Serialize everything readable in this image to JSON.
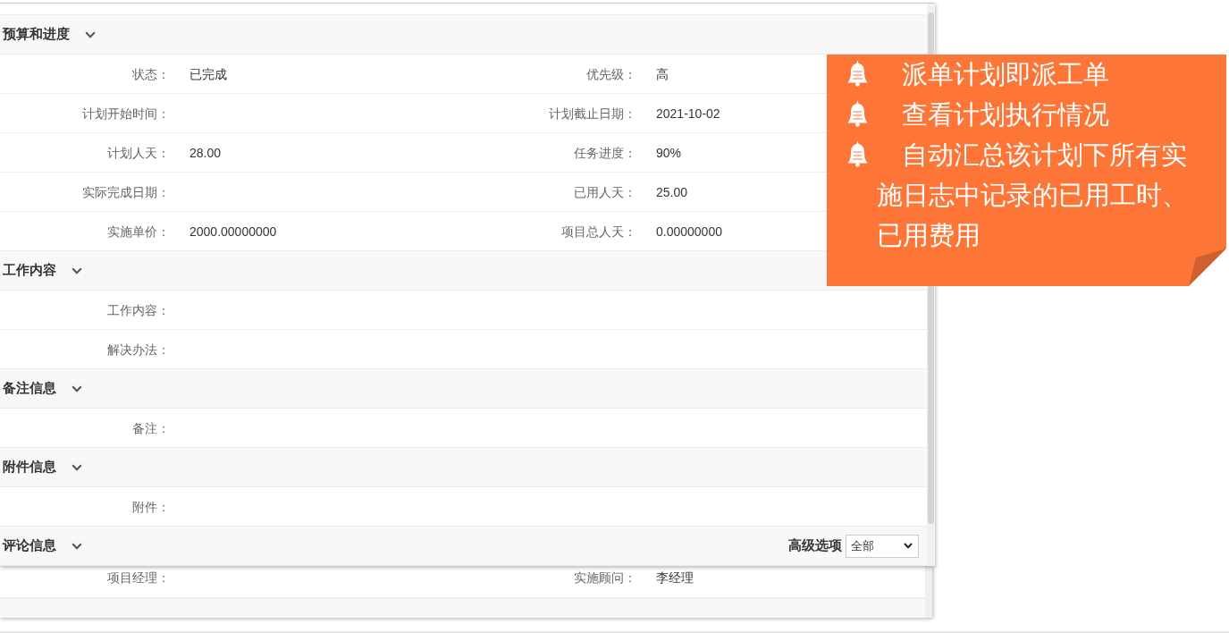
{
  "form": {
    "sections": [
      {
        "title": "预算和进度",
        "expanded": true,
        "rows": [
          {
            "fields": [
              {
                "label": "状态：",
                "value": "已完成"
              },
              {
                "label": "优先级：",
                "value": "高"
              }
            ]
          },
          {
            "fields": [
              {
                "label": "计划开始时间："
              },
              {
                "label": "计划截止日期：",
                "value": "2021-10-02"
              }
            ]
          },
          {
            "fields": [
              {
                "label": "计划人天：",
                "value": "28.00"
              },
              {
                "label": "任务进度：",
                "value": "90%"
              }
            ]
          },
          {
            "fields": [
              {
                "label": "实际完成日期："
              },
              {
                "label": "已用人天：",
                "value": "25.00"
              }
            ]
          },
          {
            "fields": [
              {
                "label": "实施单价：",
                "value": "2000.00000000"
              },
              {
                "label": "项目总人天：",
                "value": "0.00000000"
              }
            ]
          }
        ]
      },
      {
        "title": "工作内容",
        "expanded": true,
        "rows": [
          {
            "fields": [
              {
                "label": "工作内容："
              }
            ]
          },
          {
            "fields": [
              {
                "label": "解决办法："
              }
            ]
          }
        ]
      },
      {
        "title": "备注信息",
        "expanded": true,
        "rows": [
          {
            "fields": [
              {
                "label": "备注："
              }
            ]
          }
        ]
      },
      {
        "title": "附件信息",
        "expanded": true,
        "rows": [
          {
            "fields": [
              {
                "label": "附件："
              }
            ]
          }
        ]
      },
      {
        "title": "评论信息",
        "expanded": true,
        "filter": {
          "label": "高级选项",
          "value": "全部"
        }
      }
    ]
  },
  "callout": {
    "items": [
      {
        "text": "派单计划即派工单"
      },
      {
        "text": "查看计划执行情况"
      },
      {
        "text": "自动汇总该计划下所有实施日志中记录的已用工时、已用费用"
      }
    ]
  },
  "background_form": {
    "rows": [
      {
        "fields": [
          {
            "label": "项目经理："
          },
          {
            "label": "实施顾问：",
            "value": "李经理"
          }
        ]
      }
    ]
  }
}
